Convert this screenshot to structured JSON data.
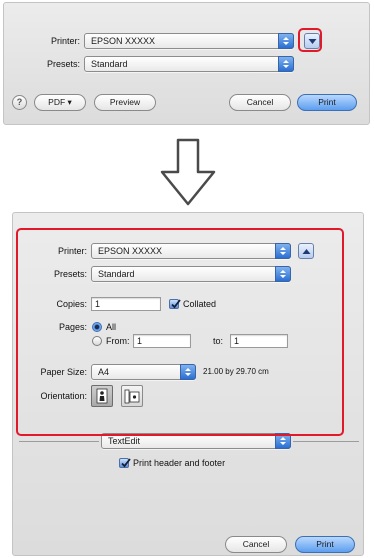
{
  "top_dialog": {
    "printer_label": "Printer:",
    "printer_value": "EPSON XXXXX",
    "presets_label": "Presets:",
    "presets_value": "Standard",
    "help_label": "?",
    "pdf_label": "PDF ▾",
    "preview_label": "Preview",
    "cancel_label": "Cancel",
    "print_label": "Print"
  },
  "bottom_dialog": {
    "printer_label": "Printer:",
    "printer_value": "EPSON XXXXX",
    "presets_label": "Presets:",
    "presets_value": "Standard",
    "copies_label": "Copies:",
    "copies_value": "1",
    "collated_label": "Collated",
    "collated_checked": true,
    "pages_label": "Pages:",
    "pages_all_label": "All",
    "pages_from_label": "From:",
    "pages_from_value": "1",
    "pages_to_label": "to:",
    "pages_to_value": "1",
    "paper_size_label": "Paper Size:",
    "paper_size_value": "A4",
    "paper_size_dims": "21.00 by 29.70 cm",
    "orientation_label": "Orientation:",
    "section_value": "TextEdit",
    "header_footer_label": "Print header and footer",
    "header_footer_checked": true,
    "cancel_label": "Cancel",
    "print_label": "Print"
  },
  "colors": {
    "highlight": "#e2192a",
    "accent": "#2a6fd2"
  },
  "icons": [
    "popup-arrows-icon",
    "disclosure-triangle-icon",
    "down-arrow-icon",
    "portrait-icon",
    "landscape-icon",
    "checkmark-icon"
  ]
}
